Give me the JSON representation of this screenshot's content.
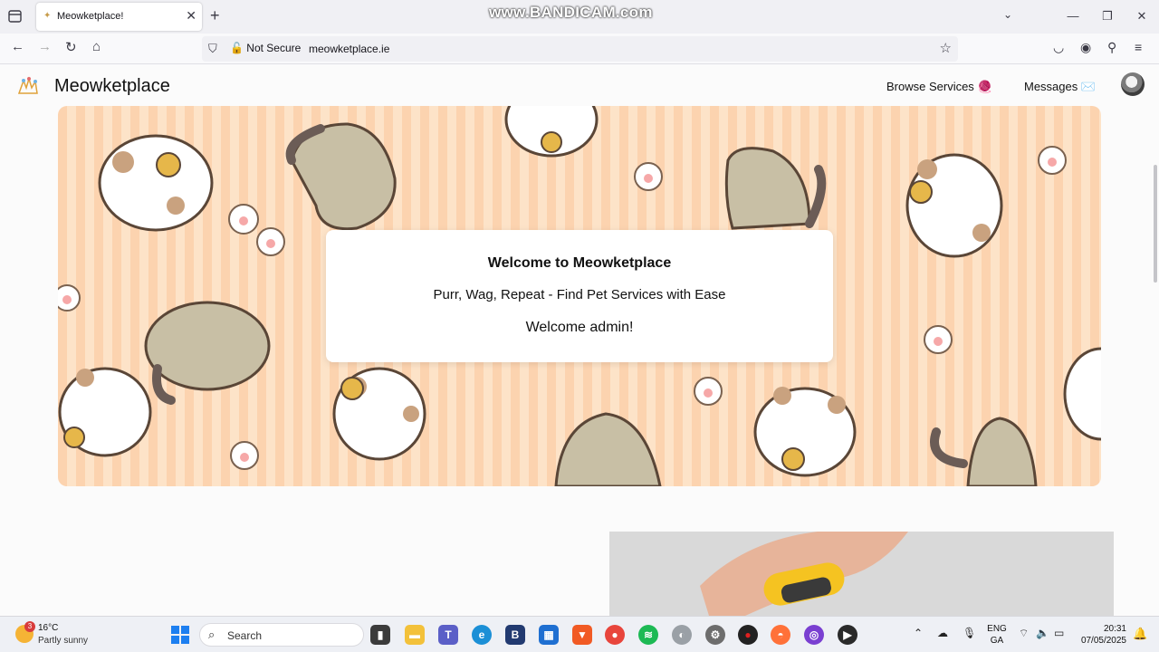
{
  "browser": {
    "watermark": "www.BANDICAM.com",
    "tab": {
      "title": "Meowketplace!",
      "favicon": "cat-favicon-icon"
    },
    "url_security": "Not Secure",
    "url": "meowketplace.ie"
  },
  "site": {
    "title": "Meowketplace",
    "nav": {
      "browse_label": "Browse Services",
      "browse_emoji": "🧶",
      "messages_label": "Messages",
      "messages_emoji": "✉️"
    }
  },
  "hero": {
    "title": "Welcome to Meowketplace",
    "subtitle": "Purr, Wag, Repeat - Find Pet Services with Ease",
    "user_greeting": "Welcome admin!"
  },
  "taskbar": {
    "weather": {
      "temp": "16°C",
      "desc": "Partly sunny",
      "badge": "3"
    },
    "search_label": "Search",
    "lang_top": "ENG",
    "lang_bottom": "GA",
    "time": "20:31",
    "date": "07/05/2025"
  },
  "colors": {
    "hero_stripe_a": "#fcd3af",
    "hero_stripe_b": "#fde3c8",
    "cat_white": "#ffffff",
    "cat_beige": "#c8bfa5",
    "accent_windows": "#1d7ff0"
  }
}
